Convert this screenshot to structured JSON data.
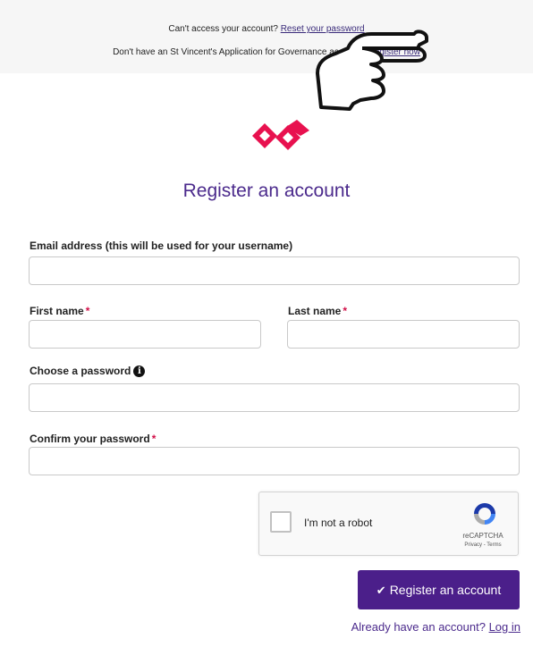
{
  "top": {
    "line1_text": "Can't access your account?",
    "line1_link": "Reset your password",
    "line2_text": "Don't have an St Vincent's Application for Governance account?",
    "line2_link": "Register now"
  },
  "title": "Register an account",
  "form": {
    "email_label": "Email address (this will be used for your username)",
    "first_name_label": "First name",
    "last_name_label": "Last name",
    "password_label": "Choose a password",
    "confirm_label": "Confirm your password",
    "required_mark": "*",
    "info_glyph": "i"
  },
  "captcha": {
    "label": "I'm not a robot",
    "brand": "reCAPTCHA",
    "terms": "Privacy - Terms"
  },
  "submit": {
    "check": "✔",
    "label": "Register an account"
  },
  "login": {
    "prompt": "Already have an account?",
    "link": "Log in"
  },
  "colors": {
    "brand_purple": "#4b1f8a",
    "required_red": "#d10f48",
    "logo_red": "#e8114f"
  }
}
